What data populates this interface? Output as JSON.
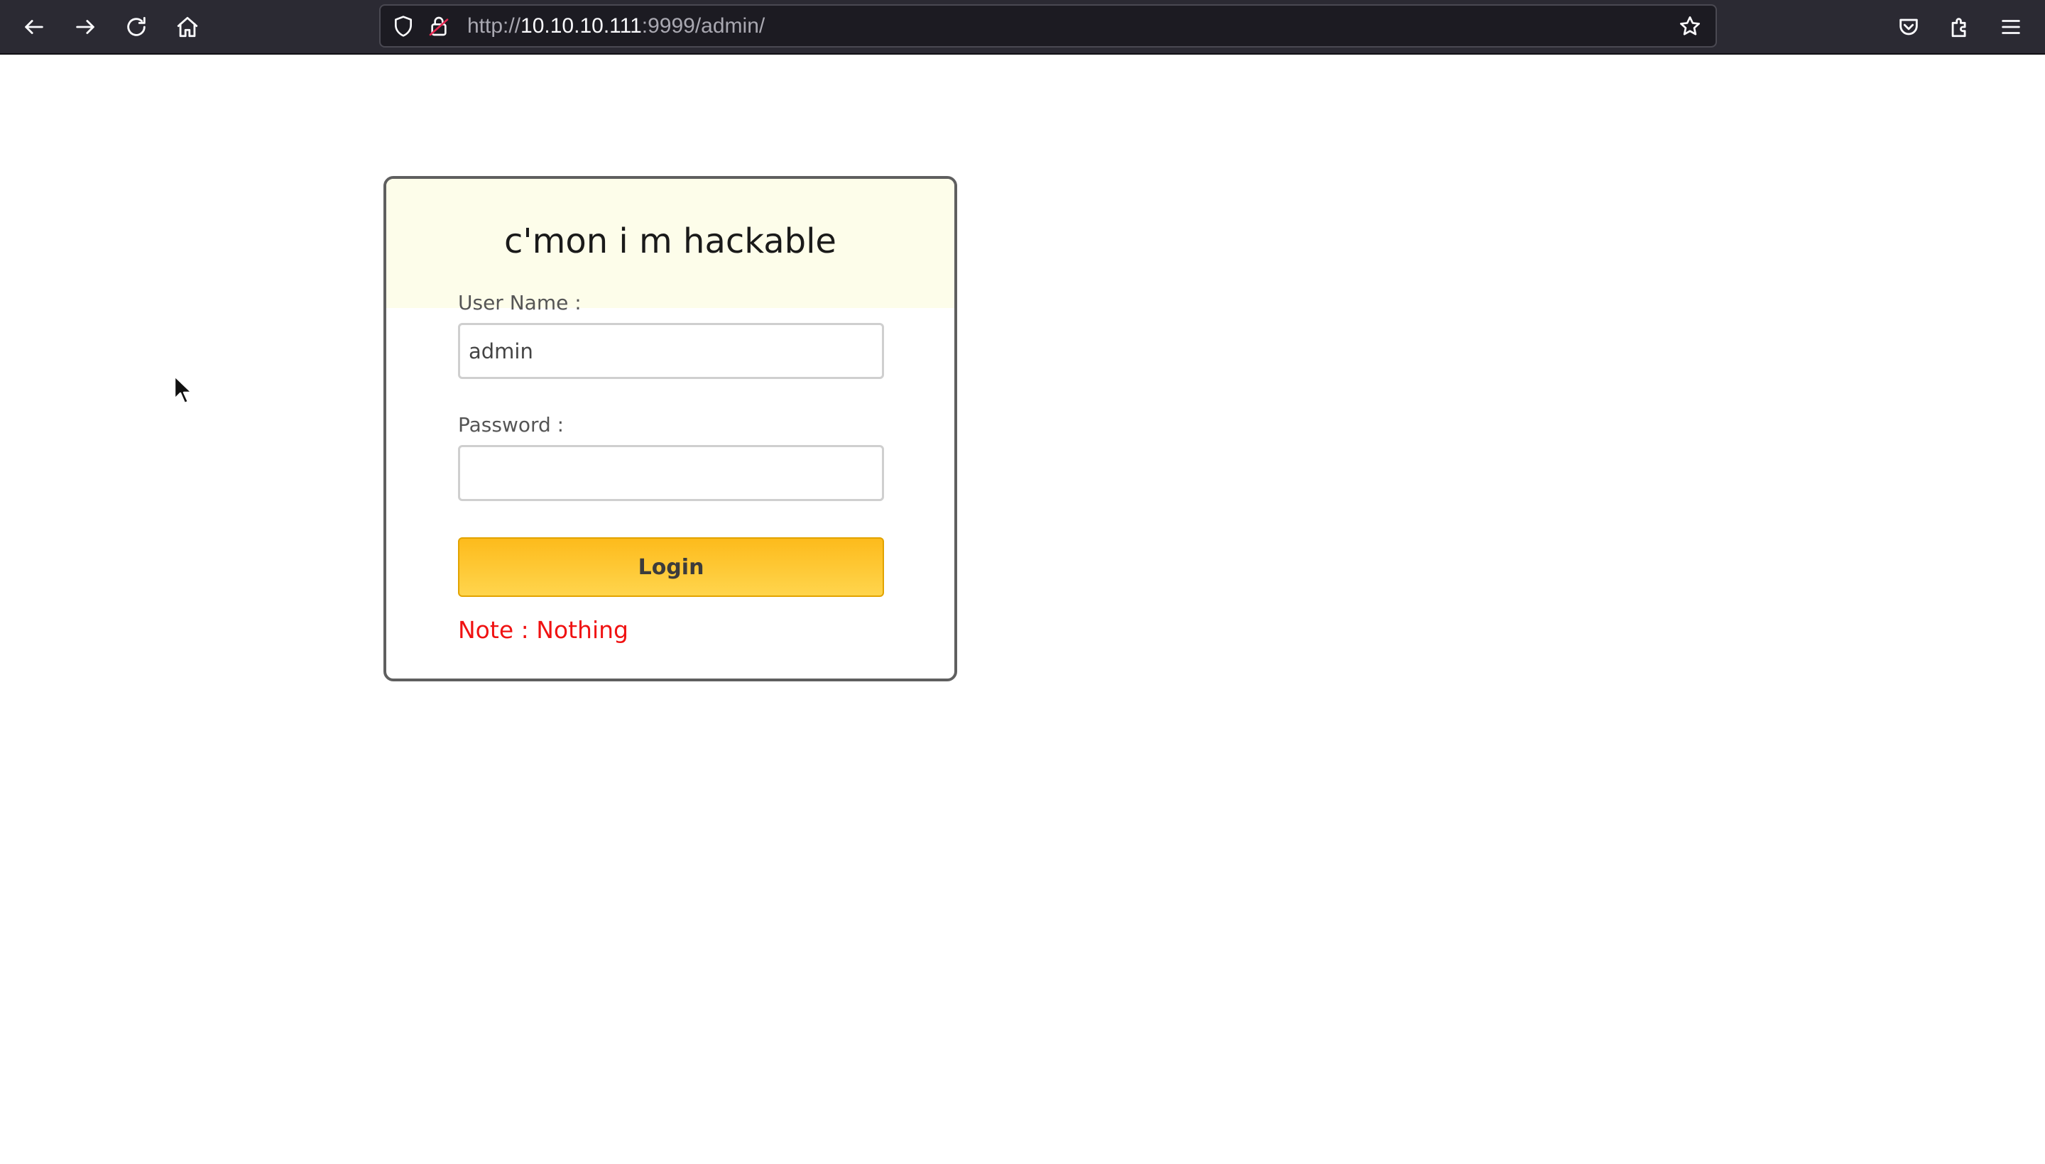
{
  "browser": {
    "url_prefix": "http://",
    "url_host": "10.10.10.111",
    "url_rest": ":9999/admin/",
    "icons": {
      "back": "arrow-left-icon",
      "forward": "arrow-right-icon",
      "reload": "reload-icon",
      "home": "home-icon",
      "shield": "shield-icon",
      "lock": "lock-icon",
      "bookmark": "star-icon",
      "pocket": "pocket-icon",
      "extensions": "puzzle-icon",
      "menu": "hamburger-menu-icon"
    }
  },
  "login": {
    "title": "c'mon i m hackable",
    "username_label": "User Name :",
    "username_value": "admin",
    "password_label": "Password :",
    "password_value": "",
    "button_label": "Login",
    "note": "Note : Nothing"
  },
  "colors": {
    "toolbar": "#2b2a33",
    "card_header": "#fdfdea",
    "button": "#fdbb1c",
    "note": "#f01212"
  }
}
